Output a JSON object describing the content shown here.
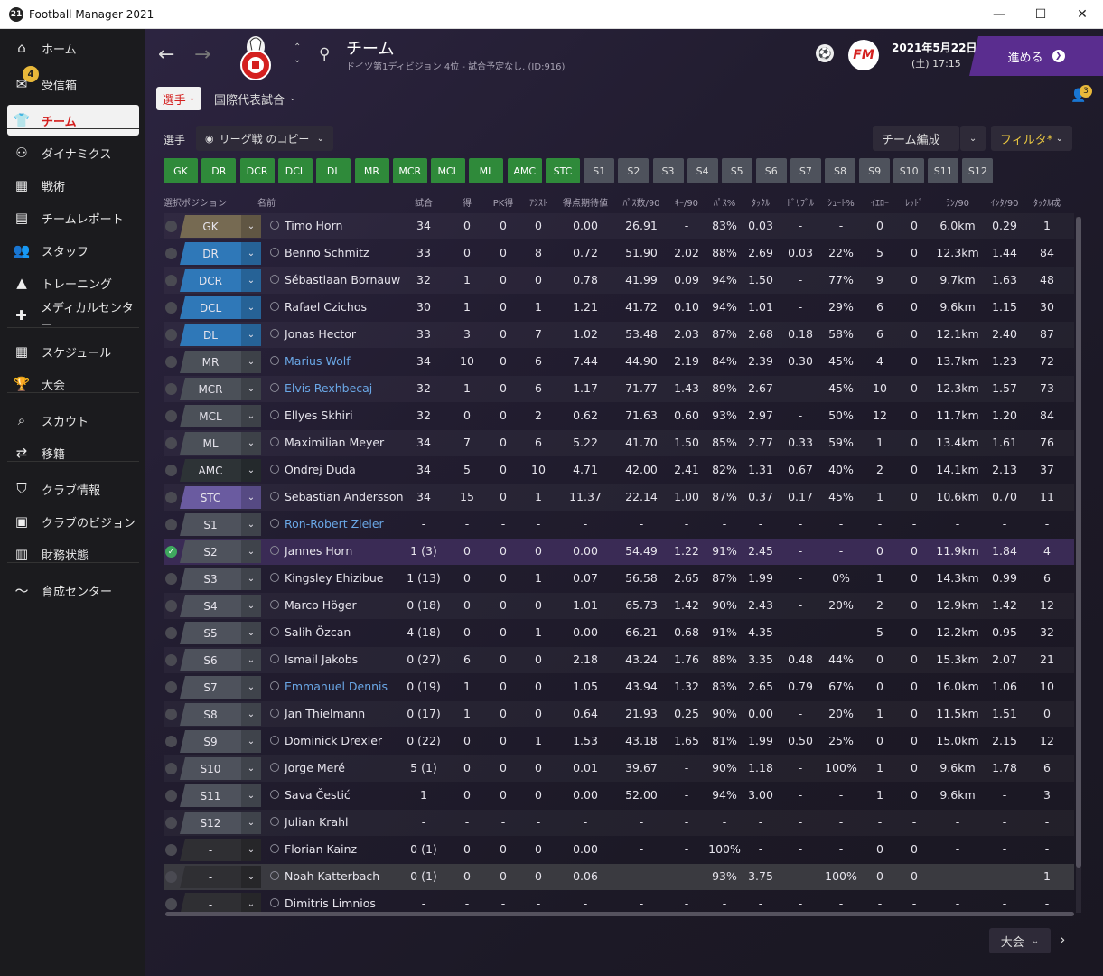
{
  "window": {
    "title": "Football Manager 2021",
    "logo": "21"
  },
  "sidebar": {
    "items": [
      {
        "label": "ホーム",
        "icon": "home-icon",
        "glyph": "⌂"
      },
      {
        "label": "受信箱",
        "icon": "inbox-icon",
        "glyph": "✉",
        "badge": "4"
      },
      {
        "label": "チーム",
        "icon": "shirt-icon",
        "glyph": "👕",
        "active": true
      },
      {
        "label": "ダイナミクス",
        "icon": "dynamics-icon",
        "glyph": "⚇"
      },
      {
        "label": "戦術",
        "icon": "tactics-icon",
        "glyph": "▦"
      },
      {
        "label": "チームレポート",
        "icon": "report-icon",
        "glyph": "▤"
      },
      {
        "label": "スタッフ",
        "icon": "staff-icon",
        "glyph": "👥"
      },
      {
        "label": "トレーニング",
        "icon": "training-icon",
        "glyph": "▲"
      },
      {
        "label": "メディカルセンター",
        "icon": "medical-icon",
        "glyph": "✚"
      },
      {
        "label": "スケジュール",
        "icon": "calendar-icon",
        "glyph": "▦"
      },
      {
        "label": "大会",
        "icon": "trophy-icon",
        "glyph": "🏆"
      },
      {
        "label": "スカウト",
        "icon": "scout-icon",
        "glyph": "⌕"
      },
      {
        "label": "移籍",
        "icon": "transfer-icon",
        "glyph": "⇄"
      },
      {
        "label": "クラブ情報",
        "icon": "club-icon",
        "glyph": "⛉"
      },
      {
        "label": "クラブのビジョン",
        "icon": "vision-icon",
        "glyph": "▣"
      },
      {
        "label": "財務状態",
        "icon": "finance-icon",
        "glyph": "▥"
      },
      {
        "label": "育成センター",
        "icon": "development-icon",
        "glyph": "〜"
      }
    ]
  },
  "header": {
    "title": "チーム",
    "subtitle": "ドイツ第1ディビジョン 4位 - 試合予定なし. (ID:916)",
    "date": "2021年5月22日",
    "weekday": "(土) 17:15",
    "advance_label": "進める",
    "fm_logo": "FM",
    "notifications": "3"
  },
  "tabs": {
    "players": "選手",
    "international": "国際代表試合"
  },
  "toolbar": {
    "players_label": "選手",
    "view": "リーグ戦 のコピー",
    "team_selection": "チーム編成",
    "filter": "フィルタ*"
  },
  "positions": [
    "GK",
    "DR",
    "DCR",
    "DCL",
    "DL",
    "MR",
    "MCR",
    "MCL",
    "ML",
    "AMC",
    "STC",
    "S1",
    "S2",
    "S3",
    "S4",
    "S5",
    "S6",
    "S7",
    "S8",
    "S9",
    "S10",
    "S11",
    "S12"
  ],
  "columns": [
    "選択ポジション",
    "名前",
    "試合",
    "得",
    "PK得",
    "ｱｼｽﾄ",
    "得点期待値",
    "ﾊﾟｽ数/90",
    "ｷｰ/90",
    "ﾊﾟｽ%",
    "ﾀｯｸﾙ",
    "ﾄﾞﾘﾌﾞﾙ",
    "ｼｭｰﾄ%",
    "ｲｴﾛｰ",
    "ﾚｯﾄﾞ",
    "ﾗﾝ/90",
    "ｲﾝﾀ/90",
    "ﾀｯｸﾙ成"
  ],
  "players": [
    {
      "pos": "GK",
      "name": "Timo Horn",
      "apps": "34",
      "gls": "0",
      "pen": "0",
      "ast": "0",
      "xg": "0.00",
      "pas": "26.91",
      "kp": "-",
      "pct": "83%",
      "tck": "0.03",
      "drb": "-",
      "shot": "-",
      "yel": "0",
      "red": "0",
      "dist": "6.0km",
      "int": "0.29",
      "tckw": "1"
    },
    {
      "pos": "DR",
      "name": "Benno Schmitz",
      "apps": "33",
      "gls": "0",
      "pen": "0",
      "ast": "8",
      "xg": "0.72",
      "pas": "51.90",
      "kp": "2.02",
      "pct": "88%",
      "tck": "2.69",
      "drb": "0.03",
      "shot": "22%",
      "yel": "5",
      "red": "0",
      "dist": "12.3km",
      "int": "1.44",
      "tckw": "84"
    },
    {
      "pos": "DCR",
      "name": "Sébastiaan Bornauw",
      "apps": "32",
      "gls": "1",
      "pen": "0",
      "ast": "0",
      "xg": "0.78",
      "pas": "41.99",
      "kp": "0.09",
      "pct": "94%",
      "tck": "1.50",
      "drb": "-",
      "shot": "77%",
      "yel": "9",
      "red": "0",
      "dist": "9.7km",
      "int": "1.63",
      "tckw": "48"
    },
    {
      "pos": "DCL",
      "name": "Rafael Czichos",
      "apps": "30",
      "gls": "1",
      "pen": "0",
      "ast": "1",
      "xg": "1.21",
      "pas": "41.72",
      "kp": "0.10",
      "pct": "94%",
      "tck": "1.01",
      "drb": "-",
      "shot": "29%",
      "yel": "6",
      "red": "0",
      "dist": "9.6km",
      "int": "1.15",
      "tckw": "30"
    },
    {
      "pos": "DL",
      "name": "Jonas Hector",
      "apps": "33",
      "gls": "3",
      "pen": "0",
      "ast": "7",
      "xg": "1.02",
      "pas": "53.48",
      "kp": "2.03",
      "pct": "87%",
      "tck": "2.68",
      "drb": "0.18",
      "shot": "58%",
      "yel": "6",
      "red": "0",
      "dist": "12.1km",
      "int": "2.40",
      "tckw": "87"
    },
    {
      "pos": "MR",
      "name": "Marius Wolf",
      "link": true,
      "apps": "34",
      "gls": "10",
      "pen": "0",
      "ast": "6",
      "xg": "7.44",
      "pas": "44.90",
      "kp": "2.19",
      "pct": "84%",
      "tck": "2.39",
      "drb": "0.30",
      "shot": "45%",
      "yel": "4",
      "red": "0",
      "dist": "13.7km",
      "int": "1.23",
      "tckw": "72"
    },
    {
      "pos": "MCR",
      "name": "Elvis Rexhbecaj",
      "link": true,
      "apps": "32",
      "gls": "1",
      "pen": "0",
      "ast": "6",
      "xg": "1.17",
      "pas": "71.77",
      "kp": "1.43",
      "pct": "89%",
      "tck": "2.67",
      "drb": "-",
      "shot": "45%",
      "yel": "10",
      "red": "0",
      "dist": "12.3km",
      "int": "1.57",
      "tckw": "73"
    },
    {
      "pos": "MCL",
      "name": "Ellyes Skhiri",
      "apps": "32",
      "gls": "0",
      "pen": "0",
      "ast": "2",
      "xg": "0.62",
      "pas": "71.63",
      "kp": "0.60",
      "pct": "93%",
      "tck": "2.97",
      "drb": "-",
      "shot": "50%",
      "yel": "12",
      "red": "0",
      "dist": "11.7km",
      "int": "1.20",
      "tckw": "84"
    },
    {
      "pos": "ML",
      "name": "Maximilian Meyer",
      "apps": "34",
      "gls": "7",
      "pen": "0",
      "ast": "6",
      "xg": "5.22",
      "pas": "41.70",
      "kp": "1.50",
      "pct": "85%",
      "tck": "2.77",
      "drb": "0.33",
      "shot": "59%",
      "yel": "1",
      "red": "0",
      "dist": "13.4km",
      "int": "1.61",
      "tckw": "76"
    },
    {
      "pos": "AMC",
      "name": "Ondrej Duda",
      "apps": "34",
      "gls": "5",
      "pen": "0",
      "ast": "10",
      "xg": "4.71",
      "pas": "42.00",
      "kp": "2.41",
      "pct": "82%",
      "tck": "1.31",
      "drb": "0.67",
      "shot": "40%",
      "yel": "2",
      "red": "0",
      "dist": "14.1km",
      "int": "2.13",
      "tckw": "37"
    },
    {
      "pos": "STC",
      "name": "Sebastian Andersson",
      "apps": "34",
      "gls": "15",
      "pen": "0",
      "ast": "1",
      "xg": "11.37",
      "pas": "22.14",
      "kp": "1.00",
      "pct": "87%",
      "tck": "0.37",
      "drb": "0.17",
      "shot": "45%",
      "yel": "1",
      "red": "0",
      "dist": "10.6km",
      "int": "0.70",
      "tckw": "11"
    },
    {
      "pos": "S1",
      "name": "Ron-Robert Zieler",
      "link": true,
      "apps": "-",
      "gls": "-",
      "pen": "-",
      "ast": "-",
      "xg": "-",
      "pas": "-",
      "kp": "-",
      "pct": "-",
      "tck": "-",
      "drb": "-",
      "shot": "-",
      "yel": "-",
      "red": "-",
      "dist": "-",
      "int": "-",
      "tckw": "-"
    },
    {
      "pos": "S2",
      "name": "Jannes Horn",
      "selected": true,
      "apps": "1 (3)",
      "gls": "0",
      "pen": "0",
      "ast": "0",
      "xg": "0.00",
      "pas": "54.49",
      "kp": "1.22",
      "pct": "91%",
      "tck": "2.45",
      "drb": "-",
      "shot": "-",
      "yel": "0",
      "red": "0",
      "dist": "11.9km",
      "int": "1.84",
      "tckw": "4"
    },
    {
      "pos": "S3",
      "name": "Kingsley Ehizibue",
      "apps": "1 (13)",
      "gls": "0",
      "pen": "0",
      "ast": "1",
      "xg": "0.07",
      "pas": "56.58",
      "kp": "2.65",
      "pct": "87%",
      "tck": "1.99",
      "drb": "-",
      "shot": "0%",
      "yel": "1",
      "red": "0",
      "dist": "14.3km",
      "int": "0.99",
      "tckw": "6"
    },
    {
      "pos": "S4",
      "name": "Marco Höger",
      "apps": "0 (18)",
      "gls": "0",
      "pen": "0",
      "ast": "0",
      "xg": "1.01",
      "pas": "65.73",
      "kp": "1.42",
      "pct": "90%",
      "tck": "2.43",
      "drb": "-",
      "shot": "20%",
      "yel": "2",
      "red": "0",
      "dist": "12.9km",
      "int": "1.42",
      "tckw": "12"
    },
    {
      "pos": "S5",
      "name": "Salih Özcan",
      "apps": "4 (18)",
      "gls": "0",
      "pen": "0",
      "ast": "1",
      "xg": "0.00",
      "pas": "66.21",
      "kp": "0.68",
      "pct": "91%",
      "tck": "4.35",
      "drb": "-",
      "shot": "-",
      "yel": "5",
      "red": "0",
      "dist": "12.2km",
      "int": "0.95",
      "tckw": "32"
    },
    {
      "pos": "S6",
      "name": "Ismail Jakobs",
      "apps": "0 (27)",
      "gls": "6",
      "pen": "0",
      "ast": "0",
      "xg": "2.18",
      "pas": "43.24",
      "kp": "1.76",
      "pct": "88%",
      "tck": "3.35",
      "drb": "0.48",
      "shot": "44%",
      "yel": "0",
      "red": "0",
      "dist": "15.3km",
      "int": "2.07",
      "tckw": "21"
    },
    {
      "pos": "S7",
      "name": "Emmanuel Dennis",
      "link": true,
      "apps": "0 (19)",
      "gls": "1",
      "pen": "0",
      "ast": "0",
      "xg": "1.05",
      "pas": "43.94",
      "kp": "1.32",
      "pct": "83%",
      "tck": "2.65",
      "drb": "0.79",
      "shot": "67%",
      "yel": "0",
      "red": "0",
      "dist": "16.0km",
      "int": "1.06",
      "tckw": "10"
    },
    {
      "pos": "S8",
      "name": "Jan Thielmann",
      "apps": "0 (17)",
      "gls": "1",
      "pen": "0",
      "ast": "0",
      "xg": "0.64",
      "pas": "21.93",
      "kp": "0.25",
      "pct": "90%",
      "tck": "0.00",
      "drb": "-",
      "shot": "20%",
      "yel": "1",
      "red": "0",
      "dist": "11.5km",
      "int": "1.51",
      "tckw": "0"
    },
    {
      "pos": "S9",
      "name": "Dominick Drexler",
      "apps": "0 (22)",
      "gls": "0",
      "pen": "0",
      "ast": "1",
      "xg": "1.53",
      "pas": "43.18",
      "kp": "1.65",
      "pct": "81%",
      "tck": "1.99",
      "drb": "0.50",
      "shot": "25%",
      "yel": "0",
      "red": "0",
      "dist": "15.0km",
      "int": "2.15",
      "tckw": "12"
    },
    {
      "pos": "S10",
      "name": "Jorge Meré",
      "apps": "5 (1)",
      "gls": "0",
      "pen": "0",
      "ast": "0",
      "xg": "0.01",
      "pas": "39.67",
      "kp": "-",
      "pct": "90%",
      "tck": "1.18",
      "drb": "-",
      "shot": "100%",
      "yel": "1",
      "red": "0",
      "dist": "9.6km",
      "int": "1.78",
      "tckw": "6"
    },
    {
      "pos": "S11",
      "name": "Sava Čestić",
      "apps": "1",
      "gls": "0",
      "pen": "0",
      "ast": "0",
      "xg": "0.00",
      "pas": "52.00",
      "kp": "-",
      "pct": "94%",
      "tck": "3.00",
      "drb": "-",
      "shot": "-",
      "yel": "1",
      "red": "0",
      "dist": "9.6km",
      "int": "-",
      "tckw": "3"
    },
    {
      "pos": "S12",
      "name": "Julian Krahl",
      "apps": "-",
      "gls": "-",
      "pen": "-",
      "ast": "-",
      "xg": "-",
      "pas": "-",
      "kp": "-",
      "pct": "-",
      "tck": "-",
      "drb": "-",
      "shot": "-",
      "yel": "-",
      "red": "-",
      "dist": "-",
      "int": "-",
      "tckw": "-"
    },
    {
      "pos": "-",
      "name": "Florian Kainz",
      "reserve": true,
      "apps": "0 (1)",
      "gls": "0",
      "pen": "0",
      "ast": "0",
      "xg": "0.00",
      "pas": "-",
      "kp": "-",
      "pct": "100%",
      "tck": "-",
      "drb": "-",
      "shot": "-",
      "yel": "0",
      "red": "0",
      "dist": "-",
      "int": "-",
      "tckw": "-"
    },
    {
      "pos": "-",
      "name": "Noah Katterbach",
      "reserve": true,
      "apps": "0 (1)",
      "gls": "0",
      "pen": "0",
      "ast": "0",
      "xg": "0.06",
      "pas": "-",
      "kp": "-",
      "pct": "93%",
      "tck": "3.75",
      "drb": "-",
      "shot": "100%",
      "yel": "0",
      "red": "0",
      "dist": "-",
      "int": "-",
      "tckw": "1"
    },
    {
      "pos": "-",
      "name": "Dimitris Limnios",
      "reserve": true,
      "apps": "-",
      "gls": "-",
      "pen": "-",
      "ast": "-",
      "xg": "-",
      "pas": "-",
      "kp": "-",
      "pct": "-",
      "tck": "-",
      "drb": "-",
      "shot": "-",
      "yel": "-",
      "red": "-",
      "dist": "-",
      "int": "-",
      "tckw": "-"
    }
  ],
  "footer": {
    "competition": "大会"
  },
  "colors": {
    "gk": "#766a52",
    "defence": "#2f78b8",
    "midfield": "#4b5058",
    "attack_mid": "#2d3336",
    "striker": "#6a5ba0",
    "sub": "#4e525c",
    "reserve": "#2f2f33",
    "accent": "#5a2d8f"
  }
}
